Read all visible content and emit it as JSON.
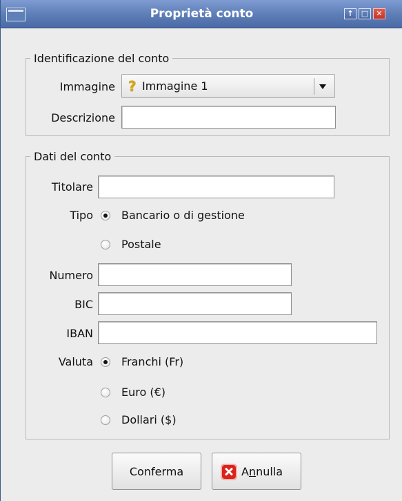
{
  "window": {
    "title": "Proprietà conto"
  },
  "section_id": {
    "legend": "Identificazione del conto",
    "immagine_label": "Immagine",
    "immagine_value": "Immagine 1",
    "descrizione_label": "Descrizione",
    "descrizione_value": ""
  },
  "section_data": {
    "legend": "Dati del conto",
    "titolare_label": "Titolare",
    "titolare_value": "",
    "tipo_label": "Tipo",
    "tipo_options": [
      "Bancario o di gestione",
      "Postale"
    ],
    "tipo_selected": "Bancario o di gestione",
    "numero_label": "Numero",
    "numero_value": "",
    "bic_label": "BIC",
    "bic_value": "",
    "iban_label": "IBAN",
    "iban_value": "",
    "valuta_label": "Valuta",
    "valuta_options": [
      "Franchi (Fr)",
      "Euro (€)",
      "Dollari ($)"
    ],
    "valuta_selected": "Franchi (Fr)"
  },
  "buttons": {
    "confirm": "Conferma",
    "cancel_prefix": "A",
    "cancel_mnemonic": "n",
    "cancel_suffix": "nulla"
  },
  "icons": {
    "combo": "question-mark-icon",
    "cancel": "cancel-x-icon"
  }
}
